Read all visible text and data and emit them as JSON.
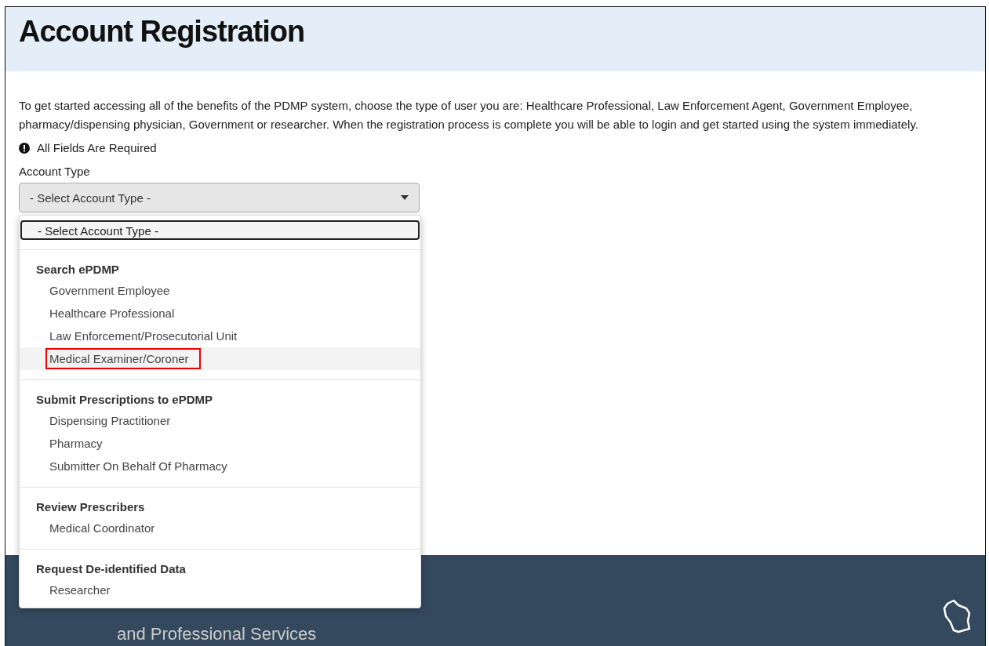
{
  "header": {
    "title": "Account Registration"
  },
  "intro": "To get started accessing all of the benefits of the PDMP system, choose the type of user you are: Healthcare Professional, Law Enforcement Agent, Government Employee, pharmacy/dispensing physician, Government or researcher. When the registration process is complete you will be able to login and get started using the system immediately.",
  "required_notice": "All Fields Are Required",
  "account_type": {
    "label": "Account Type",
    "value": "- Select Account Type -",
    "expanded": true
  },
  "dropdown": {
    "placeholder_option": "- Select Account Type -",
    "groups": [
      {
        "label": "Search ePDMP",
        "options": [
          {
            "label": "Government Employee",
            "highlighted": false
          },
          {
            "label": "Healthcare Professional",
            "highlighted": false
          },
          {
            "label": "Law Enforcement/Prosecutorial Unit",
            "highlighted": false
          },
          {
            "label": "Medical Examiner/Coroner",
            "highlighted": true
          }
        ]
      },
      {
        "label": "Submit Prescriptions to ePDMP",
        "options": [
          {
            "label": "Dispensing Practitioner",
            "highlighted": false
          },
          {
            "label": "Pharmacy",
            "highlighted": false
          },
          {
            "label": "Submitter On Behalf Of Pharmacy",
            "highlighted": false
          }
        ]
      },
      {
        "label": "Review Prescribers",
        "options": [
          {
            "label": "Medical Coordinator",
            "highlighted": false
          }
        ]
      },
      {
        "label": "Request De-identified Data",
        "options": [
          {
            "label": "Researcher",
            "highlighted": false
          }
        ]
      }
    ]
  },
  "footer": {
    "subtitle": "and Professional Services"
  }
}
